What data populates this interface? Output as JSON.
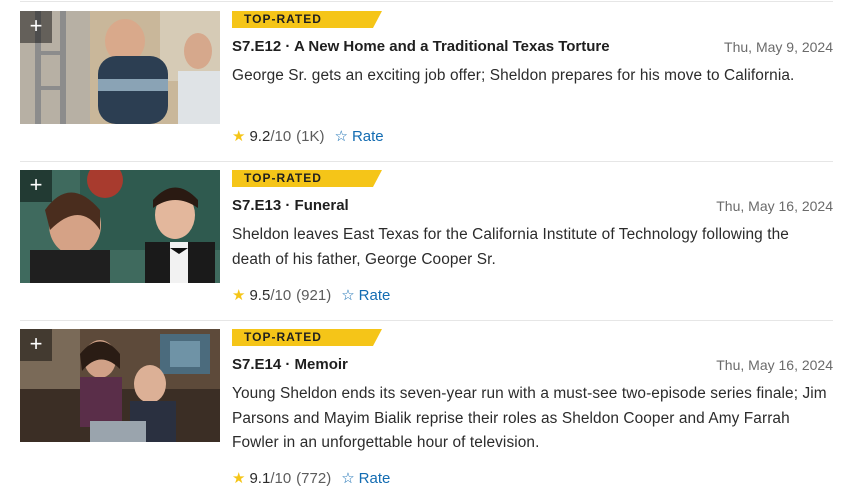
{
  "episodes": [
    {
      "badge": "TOP-RATED",
      "title": "S7.E12 · A New Home and a Traditional Texas Torture",
      "date": "Thu, May 9, 2024",
      "plot": "George Sr. gets an exciting job offer; Sheldon prepares for his move to California.",
      "score": "9.2",
      "out_of": "/10",
      "votes": "(1K)",
      "rate_label": "Rate",
      "add_icon": "+"
    },
    {
      "badge": "TOP-RATED",
      "title": "S7.E13 · Funeral",
      "date": "Thu, May 16, 2024",
      "plot": "Sheldon leaves East Texas for the California Institute of Technology following the death of his father, George Cooper Sr.",
      "score": "9.5",
      "out_of": "/10",
      "votes": "(921)",
      "rate_label": "Rate",
      "add_icon": "+"
    },
    {
      "badge": "TOP-RATED",
      "title": "S7.E14 · Memoir",
      "date": "Thu, May 16, 2024",
      "plot": "Young Sheldon ends its seven-year run with a must-see two-episode series finale; Jim Parsons and Mayim Bialik reprise their roles as Sheldon Cooper and Amy Farrah Fowler in an unforgettable hour of television.",
      "score": "9.1",
      "out_of": "/10",
      "votes": "(772)",
      "rate_label": "Rate",
      "add_icon": "+"
    }
  ],
  "colors": {
    "accent": "#f5c518",
    "link": "#136cb2",
    "muted": "#6b6b6b"
  },
  "icons": {
    "star": "star-icon",
    "rate": "star-outline-icon",
    "add": "plus-icon"
  }
}
